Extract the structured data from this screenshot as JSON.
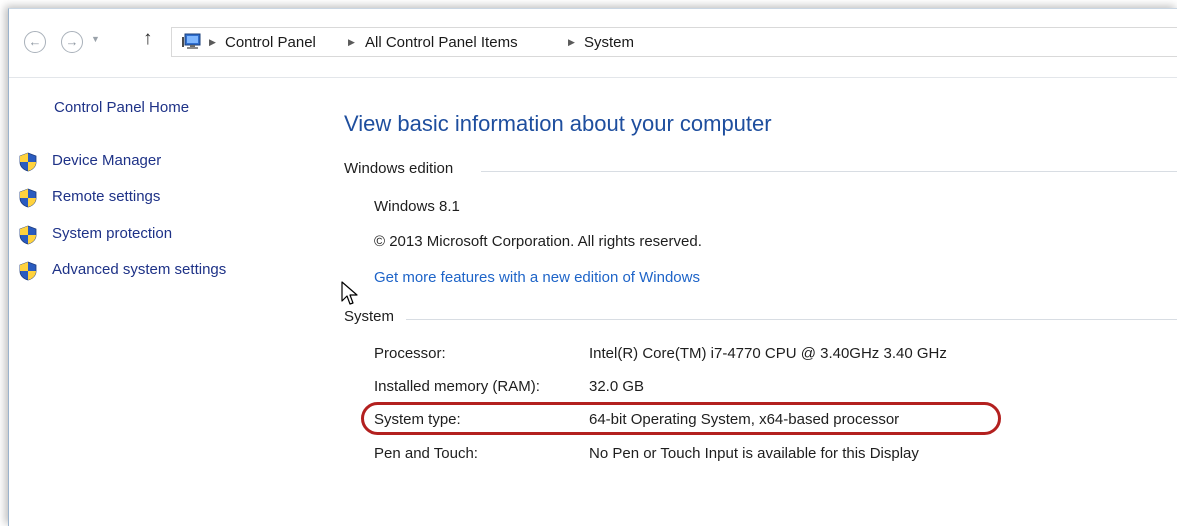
{
  "addressbar": {
    "back_icon": "back-arrow-icon",
    "forward_icon": "forward-arrow-icon",
    "up_icon": "up-arrow-icon",
    "breadcrumb": [
      "Control Panel",
      "All Control Panel Items",
      "System"
    ]
  },
  "sidebar": {
    "home": "Control Panel Home",
    "items": [
      {
        "label": "Device Manager",
        "icon": "shield-icon"
      },
      {
        "label": "Remote settings",
        "icon": "shield-icon"
      },
      {
        "label": "System protection",
        "icon": "shield-icon"
      },
      {
        "label": "Advanced system settings",
        "icon": "shield-icon"
      }
    ]
  },
  "main": {
    "title": "View basic information about your computer",
    "windows_edition": {
      "header": "Windows edition",
      "edition": "Windows 8.1",
      "copyright": "© 2013 Microsoft Corporation. All rights reserved.",
      "link": "Get more features with a new edition of Windows"
    },
    "system": {
      "header": "System",
      "rows": [
        {
          "label": "Processor:",
          "value": "Intel(R) Core(TM) i7-4770 CPU @ 3.40GHz   3.40 GHz"
        },
        {
          "label": "Installed memory (RAM):",
          "value": "32.0 GB"
        },
        {
          "label": "System type:",
          "value": "64-bit Operating System, x64-based processor"
        },
        {
          "label": "Pen and Touch:",
          "value": "No Pen or Touch Input is available for this Display"
        }
      ]
    }
  },
  "colors": {
    "link": "#1e64c8",
    "title": "#1e4e9e",
    "highlight": "#b3201f"
  }
}
